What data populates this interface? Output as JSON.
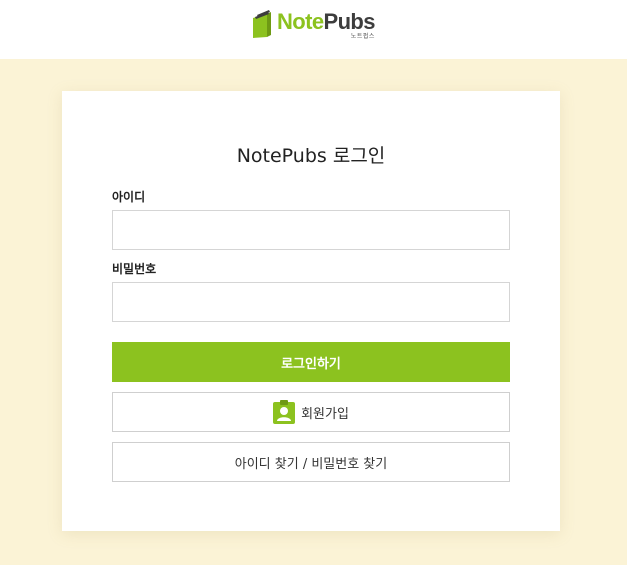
{
  "header": {
    "logo": {
      "text_part1": "Note",
      "text_part2": "Pubs",
      "subtext": "노트펍스",
      "icon": "notebook-logo-icon"
    }
  },
  "login": {
    "title": "NotePubs 로그인",
    "id_label": "아이디",
    "id_value": "",
    "password_label": "비밀번호",
    "password_value": "",
    "login_button": "로그인하기",
    "signup_button": "회원가입",
    "signup_icon": "id-badge-icon",
    "find_button": "아이디 찾기 / 비밀번호 찾기"
  },
  "colors": {
    "brand_green": "#8cc21f",
    "page_background": "#fbf3d6",
    "card_background": "#ffffff",
    "text_dark": "#222222"
  }
}
